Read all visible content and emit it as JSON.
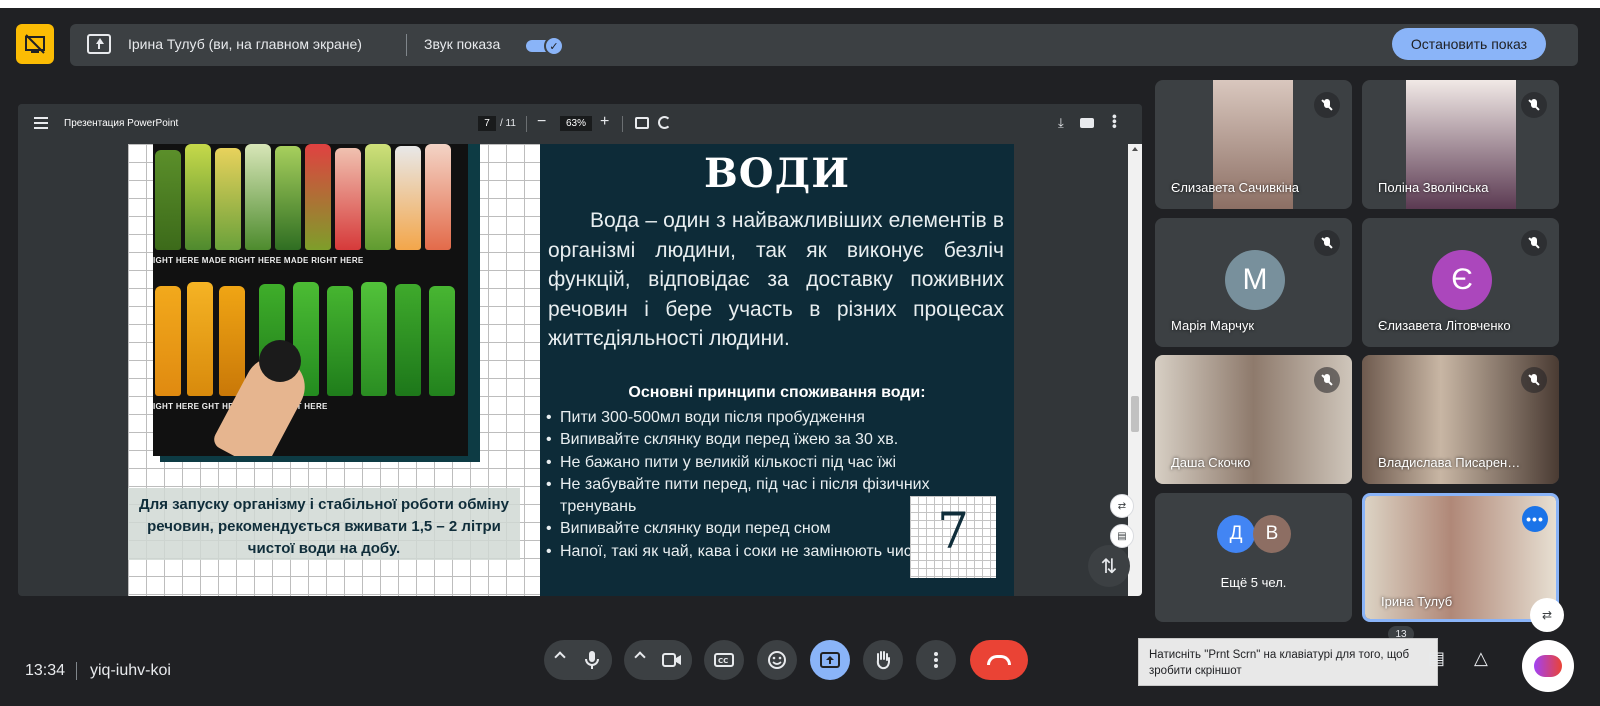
{
  "presenting_bar": {
    "presenter_text": "Ірина Тулуб (ви, на главном экране)",
    "sound_label": "Звук показа",
    "sound_on": true,
    "stop_label": "Остановить показ"
  },
  "viewer": {
    "doc_title": "Презентация PowerPoint",
    "current_page": "7",
    "page_total": "/ 11",
    "zoom": "63%"
  },
  "slide": {
    "title": "ВОДИ",
    "paragraph": "Вода – один з найважливіших елементів в організмі людини, так як виконує безліч функцій, відповідає за доставку поживних речовин і бере участь в різних процесах життєдіяльності людини.",
    "principles_title": "Основні принципи споживання води:",
    "principles": [
      "Пити 300-500мл води після пробудження",
      "Випивайте склянку води перед їжею за 30 хв.",
      "Не бажано пити у великій кількості під час їжі",
      "Не забувайте пити перед, під час і після фізичних тренувань",
      "Випивайте склянку води перед сном",
      "Напої, такі як чай, кава і соки не замінюють чисту воду"
    ],
    "caption": "Для запуску організму і стабільної роботи обміну речовин, рекомендується вживати 1,5 – 2 літри чистої води на добу.",
    "shelf_label_1": "IGHT HERE     MADE RIGHT HERE     MADE RIGHT HERE",
    "shelf_label_2": "IGHT HERE     GHT HERE     MADE RIGHT HERE",
    "page_number": "7"
  },
  "participants": [
    {
      "name": "Єлизавета Сачивкіна",
      "muted": true
    },
    {
      "name": "Поліна Зволінська",
      "muted": true
    },
    {
      "name": "Марія Марчук",
      "initial": "М",
      "avatar_color": "#78909c",
      "muted": true
    },
    {
      "name": "Єлизавета Літовченко",
      "initial": "Є",
      "avatar_color": "#ab47bc",
      "muted": true
    },
    {
      "name": "Даша Скочко",
      "muted": true
    },
    {
      "name": "Владислава Писарен…",
      "muted": true
    },
    {
      "more_label": "Ещё 5 чел.",
      "initials": [
        "Д",
        "В"
      ],
      "colors": [
        "#4285f4",
        "#8d6e63"
      ]
    },
    {
      "name": "Ірина Тулуб",
      "self": true
    }
  ],
  "bottom": {
    "clock": "13:34",
    "meeting_code": "yiq-iuhv-koi",
    "people_count": "13",
    "tooltip": "Натисніть \"Prnt Scrn\" на клавіатурі для того, щоб зробити скріншот"
  },
  "colors": {
    "accent": "#8ab4f8",
    "end_call": "#ea4335",
    "present_icon": "#fbbc04"
  }
}
